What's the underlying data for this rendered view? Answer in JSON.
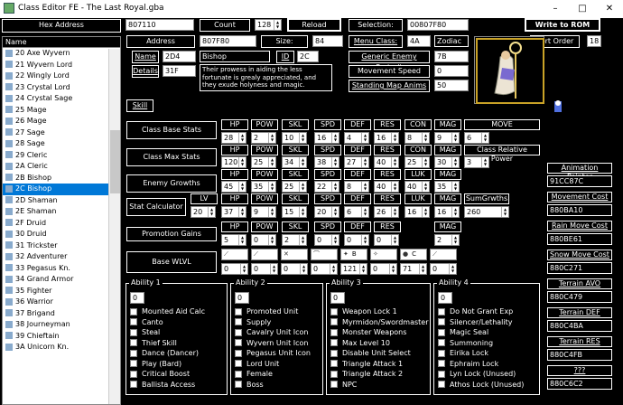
{
  "window": {
    "title": "Class Editor FE - The Last Royal.gba",
    "min": "–",
    "max": "□",
    "close": "✕"
  },
  "hex": {
    "label": "Hex Address",
    "value": "807110"
  },
  "count": {
    "label": "Count",
    "value": "128"
  },
  "reload": "Reload",
  "selection": {
    "label": "Selection:",
    "value": "00807F80"
  },
  "write": "Write to ROM",
  "address": {
    "label": "Address",
    "value": "807F80"
  },
  "size": {
    "label": "Size:",
    "value": "84"
  },
  "menu_class": {
    "label": "Menu Class:",
    "value": "4A",
    "name": "Zodiac"
  },
  "sort_order": {
    "label": "Sort Order",
    "value": "18"
  },
  "name": {
    "label": "Name",
    "id": "2D4",
    "text": "Bishop"
  },
  "id": {
    "label": "ID",
    "value": "2C"
  },
  "generic_portrait": {
    "label": "Generic Enemy Portrait",
    "value": "7B"
  },
  "details": {
    "label": "Details",
    "value": "31F"
  },
  "description": "Their prowess in aiding the less fortunate is grealy appreciated, and they exude holyness and magic.",
  "movement_speed": {
    "label": "Movement Speed",
    "value": "0"
  },
  "standing_anims": {
    "label": "Standing Map Anims",
    "value": "50"
  },
  "skill": "Skill",
  "list": {
    "header": "Name",
    "items": [
      "20 Axe Wyvern",
      "21 Wyvern Lord",
      "22 Wingly Lord",
      "23 Crystal Lord",
      "24 Crystal Sage",
      "25 Mage",
      "26 Mage",
      "27 Sage",
      "28 Sage",
      "29 Cleric",
      "2A Cleric",
      "2B Bishop",
      "2C Bishop",
      "2D Shaman",
      "2E Shaman",
      "2F Druid",
      "30 Druid",
      "31 Trickster",
      "32 Adventurer",
      "33 Pegasus Kn.",
      "34 Grand Armor",
      "35 Fighter",
      "36 Warrior",
      "37 Brigand",
      "38 Journeyman",
      "39 Chieftain",
      "3A Unicorn Kn."
    ]
  },
  "stats": {
    "headers": [
      "HP",
      "POW",
      "SKL",
      "SPD",
      "DEF",
      "RES",
      "CON",
      "MAG",
      "MOVE"
    ],
    "base": {
      "label": "Class Base Stats",
      "values": [
        "28",
        "2",
        "10",
        "16",
        "4",
        "16",
        "8",
        "9",
        "6"
      ]
    },
    "max": {
      "label": "Class Max Stats",
      "values": [
        "120",
        "25",
        "34",
        "38",
        "27",
        "40",
        "25",
        "30",
        "3"
      ],
      "rel": "Class Relative Power"
    },
    "enemy_headers": [
      "HP",
      "POW",
      "SKL",
      "SPD",
      "DEF",
      "RES",
      "LUK",
      "MAG"
    ],
    "enemy": {
      "label": "Enemy Growths",
      "values": [
        "45",
        "35",
        "25",
        "22",
        "8",
        "40",
        "40",
        "35"
      ]
    },
    "calc_headers": [
      "LV",
      "HP",
      "POW",
      "SKL",
      "SPD",
      "DEF",
      "RES",
      "LUK",
      "MAG",
      "SumGrwths"
    ],
    "calc": {
      "label": "Stat Calculator",
      "values": [
        "20",
        "37",
        "9",
        "15",
        "20",
        "6",
        "26",
        "16",
        "16",
        "260"
      ]
    },
    "promo_headers": [
      "HP",
      "POW",
      "SKL",
      "SPD",
      "DEF",
      "RES",
      "MAG"
    ],
    "promo": {
      "label": "Promotion Gains",
      "values": [
        "5",
        "0",
        "2",
        "0",
        "0",
        "0",
        "2"
      ]
    },
    "wlvl": {
      "label": "Base WLVL",
      "values": [
        "0",
        "0",
        "0",
        "0",
        "121",
        "0",
        "71",
        "0"
      ],
      "letters": [
        "",
        "",
        "",
        "",
        "B",
        "",
        "C",
        ""
      ]
    }
  },
  "abilities": [
    {
      "title": "Ability 1",
      "value": "0",
      "items": [
        "Mounted Aid Calc",
        "Canto",
        "Steal",
        "Thief Skill",
        "Dance (Dancer)",
        "Play (Bard)",
        "Critical Boost",
        "Ballista Access"
      ]
    },
    {
      "title": "Ability 2",
      "value": "0",
      "items": [
        "Promoted Unit",
        "Supply",
        "Cavalry Unit Icon",
        "Wyvern Unit Icon",
        "Pegasus Unit Icon",
        "Lord Unit",
        "Female",
        "Boss"
      ]
    },
    {
      "title": "Ability 3",
      "value": "0",
      "items": [
        "Weapon Lock 1",
        "Myrmidon/Swordmaster",
        "Monster Weapons",
        "Max Level 10",
        "Disable Unit Select",
        "Triangle Attack 1",
        "Triangle Attack 2",
        "NPC"
      ]
    },
    {
      "title": "Ability 4",
      "value": "0",
      "items": [
        "Do Not Grant Exp",
        "Silencer/Lethality",
        "Magic Seal",
        "Summoning",
        "Eirika Lock",
        "Ephraim Lock",
        "Lyn Lock (Unused)",
        "Athos Lock (Unused)"
      ]
    }
  ],
  "pointers": [
    {
      "label": "Animation Pointer",
      "value": "91CC87C"
    },
    {
      "label": "Movement Cost",
      "value": "880BA10"
    },
    {
      "label": "Rain Move Cost",
      "value": "880BE61"
    },
    {
      "label": "Snow Move Cost",
      "value": "880C271"
    },
    {
      "label": "Terrain AVO",
      "value": "880C479"
    },
    {
      "label": "Terrain DEF",
      "value": "880C4BA"
    },
    {
      "label": "Terrain RES",
      "value": "880C4FB"
    },
    {
      "label": "???",
      "value": "880C6C2"
    }
  ]
}
